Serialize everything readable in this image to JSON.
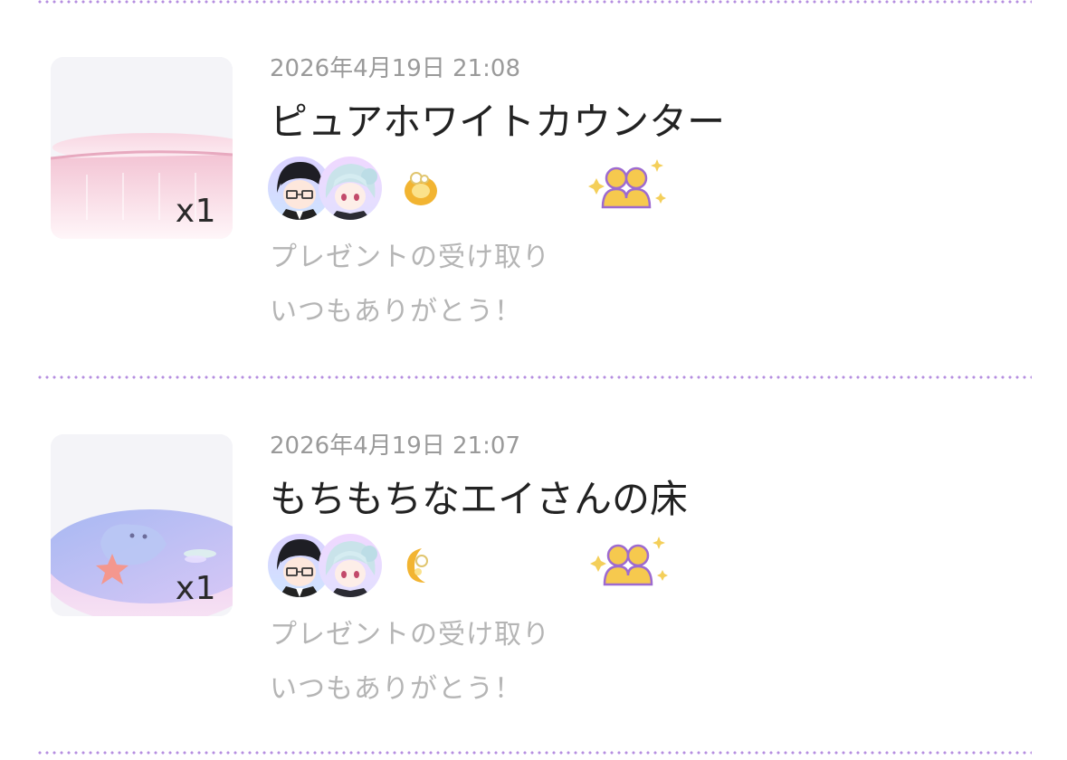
{
  "accent_color": "#b58ee0",
  "entries": [
    {
      "date": "2026年4月19日 21:08",
      "title": "ピュアホワイトカウンター",
      "quantity": "x1",
      "message_line1": "プレゼントの受け取り",
      "message_line2": "いつもありがとう！",
      "item_icon": "pink-counter-icon",
      "badge_icon": "gold-ring-icon",
      "friend_icon": "friends-sparkle-icon"
    },
    {
      "date": "2026年4月19日 21:07",
      "title": "もちもちなエイさんの床",
      "quantity": "x1",
      "message_line1": "プレゼントの受け取り",
      "message_line2": "いつもありがとう！",
      "item_icon": "manta-ray-floor-icon",
      "badge_icon": "gold-moon-icon",
      "friend_icon": "friends-sparkle-icon"
    }
  ]
}
